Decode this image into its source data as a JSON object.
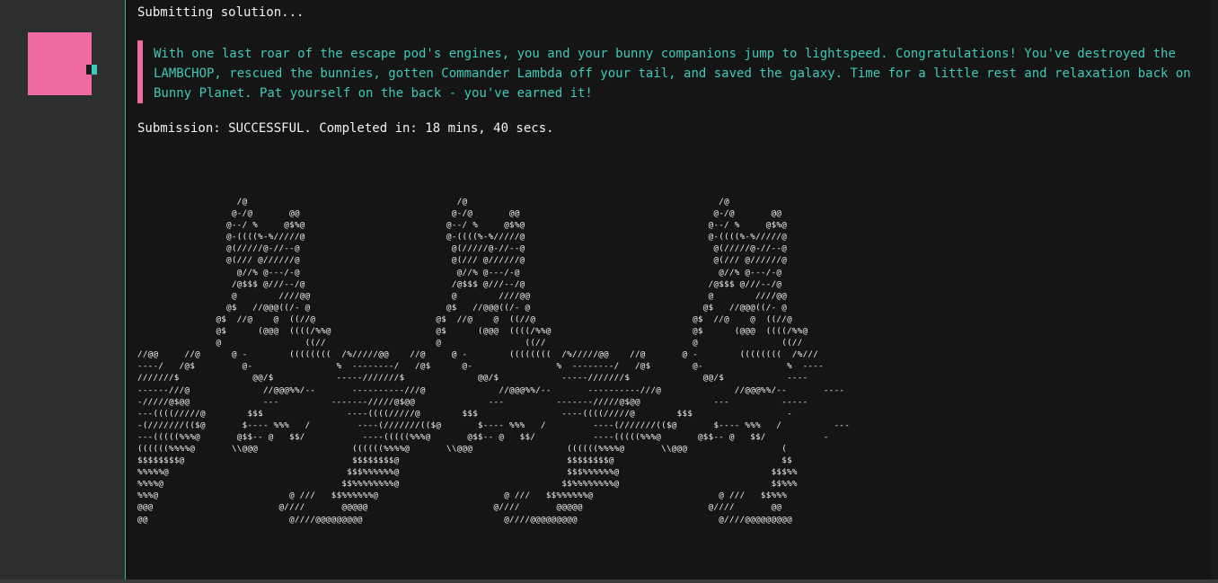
{
  "terminal": {
    "status_line": "Submitting solution...",
    "message": "With one last roar of the escape pod's engines, you and your bunny companions jump to lightspeed. Congratulations! You've destroyed the LAMBCHOP, rescued the bunnies, gotten Commander Lambda off your tail, and saved the galaxy. Time for a little rest and relaxation back on Bunny Planet. Pat yourself on the back - you've earned it!",
    "result_line": "Submission: SUCCESSFUL. Completed in: 18 mins, 40 secs.",
    "ascii_art": "                   /@                                        /@                                                /@\n                  @-/@       @@                             @-/@       @@                                     @-/@       @@\n                 @--/ %     @$%@                           @--/ %     @$%@                                   @--/ %     @$%@\n                 @-((((%-%/////@                           @-((((%-%/////@                                   @-((((%-%/////@\n                 @(/////@-//--@                             @(/////@-//--@                                    @(/////@-//--@\n                 @(/// @//////@                             @(/// @//////@                                    @(/// @//////@\n                   @//% @---/-@                              @//% @---/-@                                      @//% @---/-@\n                  /@$$$ @///--/@                            /@$$$ @///--/@                                   /@$$$ @///--/@\n                  @        ////@@                           @        ////@@                                  @        ////@@\n                 @$   //@@@((/- @                          @$   //@@@((/- @                                 @$   //@@@((/- @\n               @$  //@    @  ((//@                       @$  //@    @  ((//@                              @$  //@    @  ((//@\n               @$      (@@@  ((((/%%@                    @$      (@@@  ((((/%%@                           @$      (@@@  ((((/%%@\n               @                ((//                     @                ((//                            @                ((//\n//@@     //@      @ -        ((((((((  /%/////@@    //@     @ -        ((((((((  /%/////@@    //@       @ -        ((((((((  /%///\n----/   /@$         @-                %  --------/   /@$      @-                %  --------/   /@$        @-                %  ----\n///////$              @@/$            -----///////$              @@/$            -----///////$              @@/$            ----\n------///@              //@@@%%/--       ----------///@              //@@@%%/--       ----------///@              //@@@%%/--       ----\n-/////@$@@              ---          -------/////@$@@              ---          -------/////@$@@              ---          -----\n---((((/////@        $$$                ----((((/////@        $$$                ----((((/////@        $$$                  -\n-(///////(($@       $---- %%%   /         ----(///////(($@       $---- %%%   /         ----(///////(($@       $---- %%%   /          ---\n---(((((%%%@       @$$-- @   $$/           ----(((((%%%@       @$$-- @   $$/           ----(((((%%%@       @$$-- @   $$/           -\n((((((%%%%@       \\\\@@@                  ((((((%%%%@       \\\\@@@                  ((((((%%%%@       \\\\@@@                  (\n$$$$$$$$@                                $$$$$$$$@                                $$$$$$$$@                                $$\n%%%%%@                                  $$$%%%%%%@                                $$$%%%%%%@                             $$$%%\n%%%%@                                  $$%%%%%%%%@                               $$%%%%%%%%@                             $$%%%\n%%%@                         @ ///   $$%%%%%%@                        @ ///   $$%%%%%%@                        @ ///   $$%%%\n@@@                        @////       @@@@@                        @////       @@@@@                        @////       @@\n@@                           @////@@@@@@@@@                           @////@@@@@@@@@                           @////@@@@@@@@@"
  },
  "colors": {
    "accent_pink": "#ef69a4",
    "accent_teal": "#3fc9b8",
    "terminal_bg": "#151515",
    "sidebar_bg": "#2d2e2e"
  }
}
